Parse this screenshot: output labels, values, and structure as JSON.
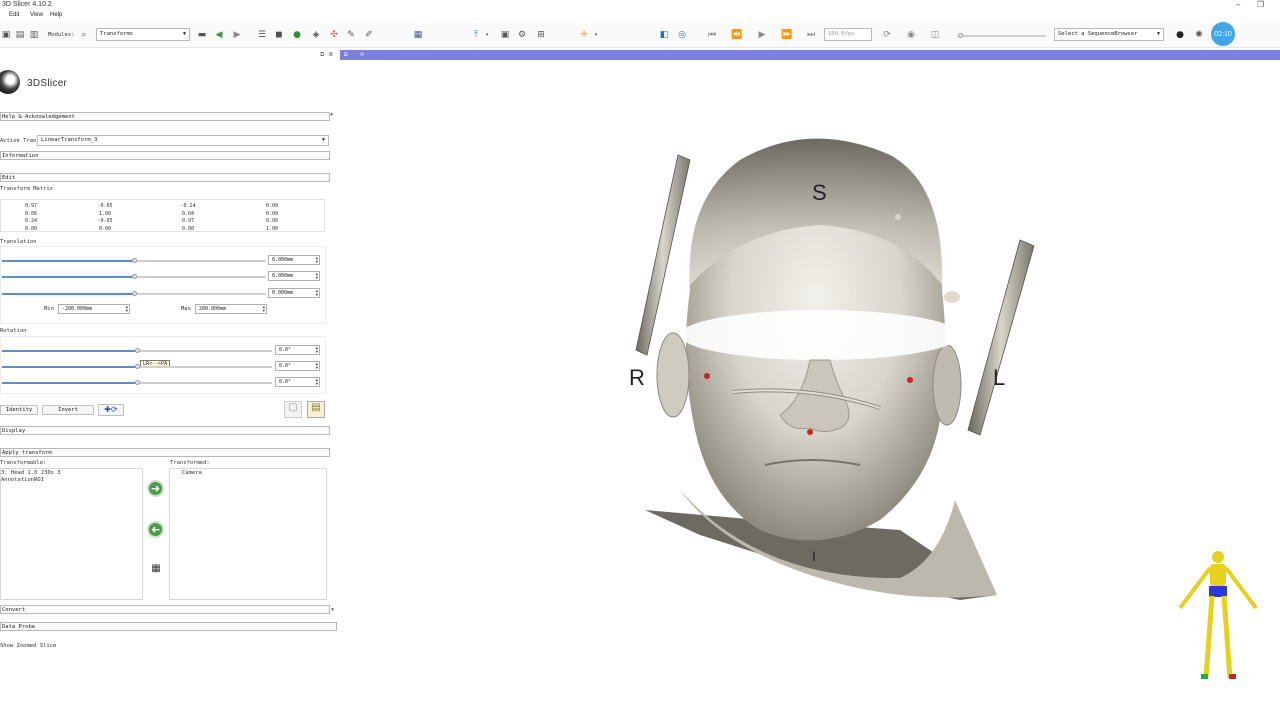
{
  "window": {
    "title": "3D Slicer 4.10.2",
    "minimize": "–",
    "restore": "❐"
  },
  "menu": {
    "edit": "Edit",
    "view": "View",
    "help": "Help"
  },
  "toolbar": {
    "modules_label": "Modules:",
    "module_selected": "Transforms",
    "fps_value": "100.0fps",
    "sequence_browser": "Select a SequenceBrowser",
    "timer": "02:10"
  },
  "logo": {
    "text": "3DSlicer"
  },
  "sections": {
    "help": "Help & Acknowledgement",
    "active_transform_label": "Active Transform:",
    "active_transform_value": "LinearTransform_3",
    "information": "Information",
    "edit": "Edit",
    "transform_matrix": "Transform Matrix",
    "translation": "Translation",
    "rotation": "Rotation",
    "display": "Display",
    "apply_transform": "Apply transform",
    "convert": "Convert",
    "data_probe": "Data Probe",
    "show_zoomed": "Show Zoomed Slice"
  },
  "matrix": [
    [
      "0.97",
      "-0.05",
      "-0.24",
      "0.00"
    ],
    [
      "0.06",
      "1.00",
      "0.04",
      "0.00"
    ],
    [
      "0.24",
      "-0.05",
      "0.97",
      "0.00"
    ],
    [
      "0.00",
      "0.00",
      "0.00",
      "1.00"
    ]
  ],
  "translation": {
    "values": [
      "0.000mm",
      "0.000mm",
      "0.000mm"
    ],
    "min_label": "Min",
    "min_value": "-200.000mm",
    "max_label": "Max",
    "max_value": "200.000mm",
    "levels": [
      0.5,
      0.5,
      0.5
    ]
  },
  "rotation": {
    "values": [
      "0.0°",
      "0.0°",
      "0.0°"
    ],
    "tooltip": "LR<-->PA",
    "levels": [
      0.5,
      0.5,
      0.5
    ]
  },
  "buttons": {
    "identity": "Identity",
    "invert": "Invert"
  },
  "apply": {
    "transformable_label": "Transformable:",
    "transformable_items": [
      "3: Head  1.0  J30x  3",
      "AnnotationROI"
    ],
    "transformed_label": "Transformed:",
    "transformed_items": [
      "Camera"
    ]
  },
  "viewer": {
    "orientation": {
      "superior": "S",
      "right": "R",
      "left": "L",
      "inferior": "I"
    }
  },
  "colors": {
    "accent_bar": "#7b7fe0",
    "slider_fill": "#5a8fc9",
    "arrow_button": "#4a9b4a",
    "marker": "#cc2222",
    "figure_body": "#e6d21a",
    "figure_pants": "#2a3bd4"
  }
}
